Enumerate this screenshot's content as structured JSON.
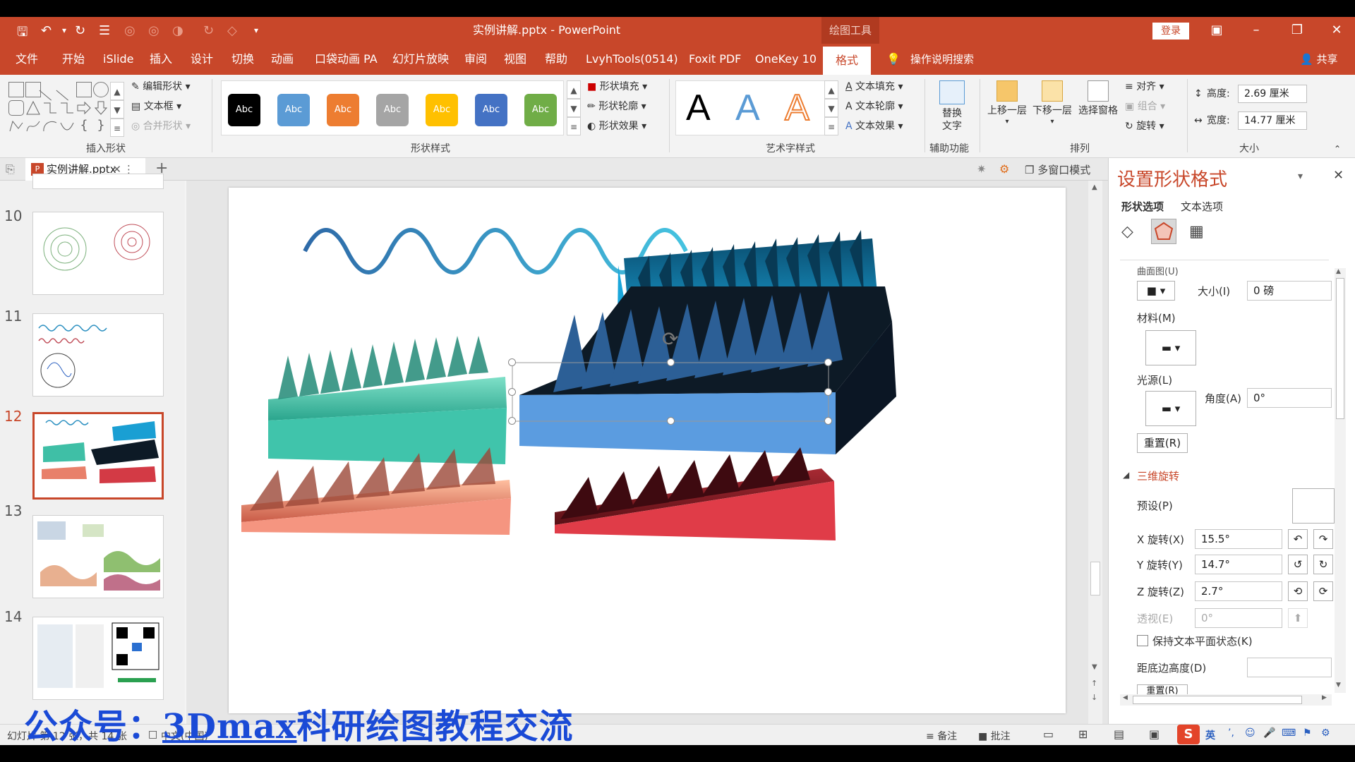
{
  "titlebar": {
    "doc_title": "实例讲解.pptx - PowerPoint",
    "context_tab": "绘图工具",
    "login": "登录"
  },
  "menu": [
    "文件",
    "开始",
    "iSlide",
    "插入",
    "设计",
    "切换",
    "动画",
    "口袋动画 PA",
    "幻灯片放映",
    "审阅",
    "视图",
    "帮助",
    "LvyhTools(0514)",
    "Foxit PDF",
    "OneKey 10"
  ],
  "menu_active": "格式",
  "search": "操作说明搜索",
  "share": "共享",
  "ribbon": {
    "insert_shape": {
      "edit_shape": "编辑形状",
      "textbox": "文本框",
      "merge": "合并形状",
      "label": "插入形状"
    },
    "shape_styles": {
      "items": [
        {
          "text": "Abc",
          "color": "#000000"
        },
        {
          "text": "Abc",
          "color": "#5b9bd5"
        },
        {
          "text": "Abc",
          "color": "#ed7d31"
        },
        {
          "text": "Abc",
          "color": "#a5a5a5"
        },
        {
          "text": "Abc",
          "color": "#ffc000"
        },
        {
          "text": "Abc",
          "color": "#4472c4"
        },
        {
          "text": "Abc",
          "color": "#70ad47"
        }
      ],
      "fill": "形状填充",
      "outline": "形状轮廓",
      "effect": "形状效果",
      "label": "形状样式"
    },
    "wordart": {
      "letters": [
        "A",
        "A",
        "A"
      ],
      "fill": "文本填充",
      "outline": "文本轮廓",
      "effect": "文本效果",
      "label": "艺术字样式"
    },
    "accessibility": {
      "alt_text_1": "替换",
      "alt_text_2": "文字",
      "label": "辅助功能"
    },
    "arrange": {
      "bring_forward": "上移一层",
      "send_backward": "下移一层",
      "selection_pane": "选择窗格",
      "align": "对齐",
      "group": "组合",
      "rotate": "旋转",
      "label": "排列"
    },
    "size": {
      "height_label": "高度:",
      "height_value": "2.69 厘米",
      "width_label": "宽度:",
      "width_value": "14.77 厘米",
      "label": "大小"
    }
  },
  "tabs": {
    "doc_tab": "实例讲解.pptx",
    "multi_window": "多窗口模式"
  },
  "thumbnails": [
    {
      "num": "10",
      "selected": false
    },
    {
      "num": "11",
      "selected": false
    },
    {
      "num": "12",
      "selected": true
    },
    {
      "num": "13",
      "selected": false
    },
    {
      "num": "14",
      "selected": false
    }
  ],
  "format_pane": {
    "title": "设置形状格式",
    "tab_shape": "形状选项",
    "tab_text": "文本选项",
    "contour_label": "曲面图(U)",
    "size_label": "大小(I)",
    "size_value": "0 磅",
    "material_label": "材料(M)",
    "lighting_label": "光源(L)",
    "angle_label": "角度(A)",
    "angle_value": "0°",
    "reset": "重置(R)",
    "rotation_section": "三维旋转",
    "preset_label": "预设(P)",
    "x_label": "X 旋转(X)",
    "x_value": "15.5°",
    "y_label": "Y 旋转(Y)",
    "y_value": "14.7°",
    "z_label": "Z 旋转(Z)",
    "z_value": "2.7°",
    "persp_label": "透视(E)",
    "persp_value": "0°",
    "keep_flat": "保持文本平面状态(K)",
    "distance_label": "距底边高度(D)",
    "reset2": "重置(R)"
  },
  "status": {
    "slide_info": "幻灯片 第 12 张，共 14 张",
    "language": "中文(中国)",
    "notes": "备注",
    "comments": "批注",
    "ime": "英"
  },
  "watermark": {
    "prefix": "公众号：",
    "underlined": "3Dmax",
    "rest": "科研绘图教程交流"
  },
  "colors": {
    "accent": "#c8472a",
    "teal": "#3fbfa6",
    "blue": "#1a9fd3",
    "black_block": "#0d1a26",
    "peach": "#e8806a",
    "red": "#d33a45"
  }
}
